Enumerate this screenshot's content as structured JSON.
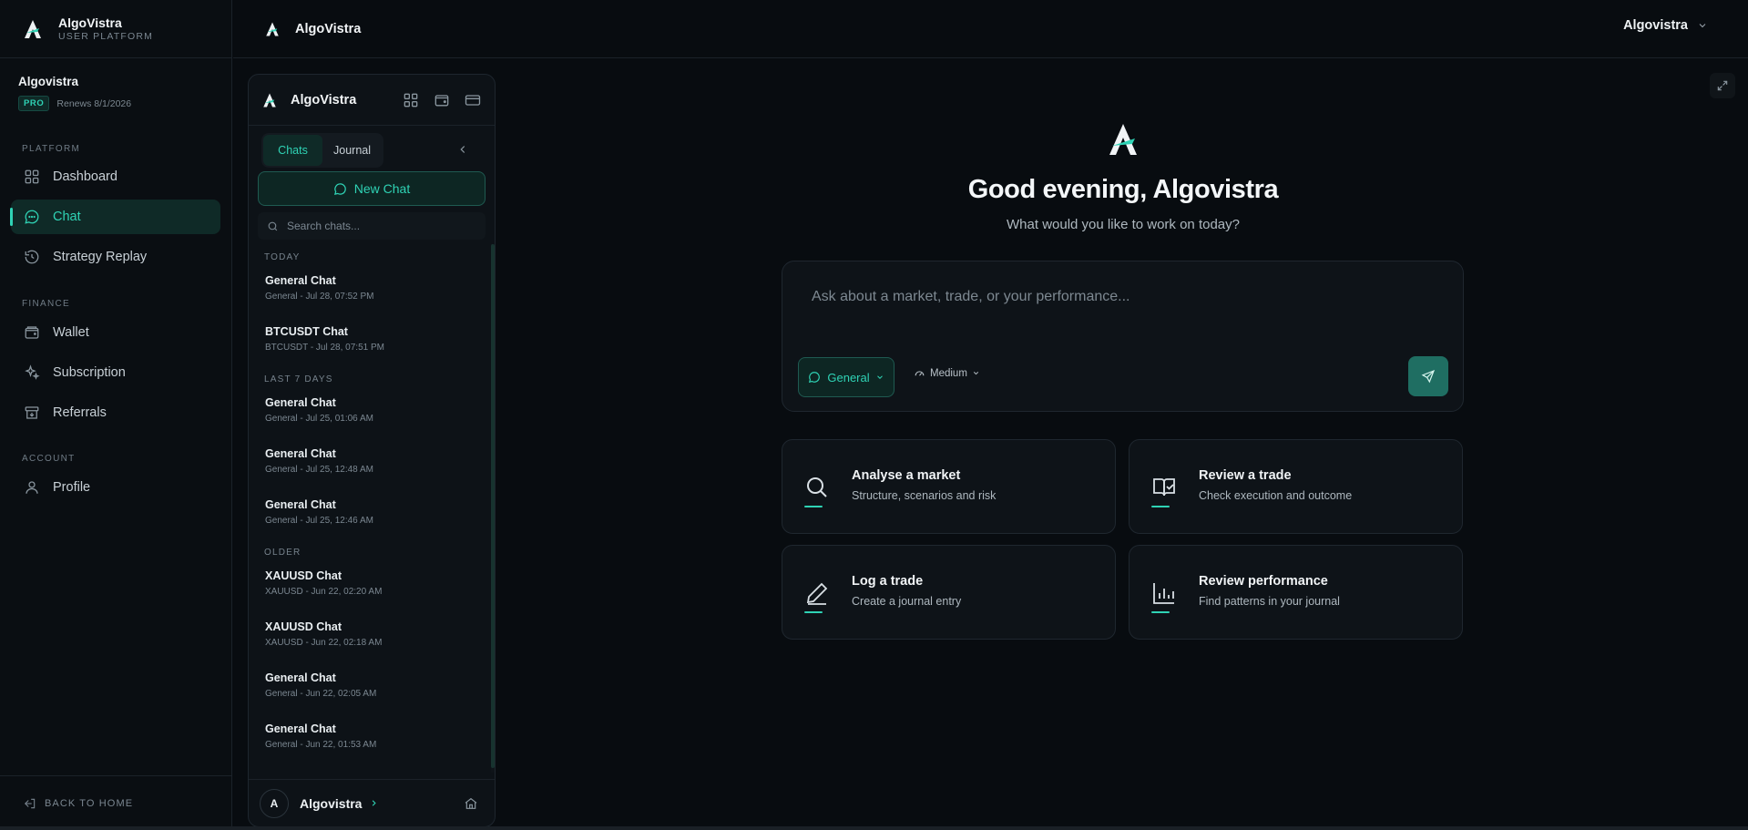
{
  "brand": {
    "name": "AlgoVistra",
    "subtitle": "USER PLATFORM"
  },
  "account": {
    "name": "Algovistra",
    "plan": "PRO",
    "renewal": "Renews 8/1/2026"
  },
  "nav": {
    "platform_label": "PLATFORM",
    "finance_label": "FINANCE",
    "account_label": "ACCOUNT",
    "items": [
      {
        "label": "Dashboard",
        "icon": "grid-icon"
      },
      {
        "label": "Chat",
        "icon": "chat-bubble-icon",
        "active": true
      },
      {
        "label": "Strategy Replay",
        "icon": "replay-icon"
      },
      {
        "label": "Wallet",
        "icon": "wallet-icon"
      },
      {
        "label": "Subscription",
        "icon": "sparkle-icon"
      },
      {
        "label": "Referrals",
        "icon": "gift-icon"
      },
      {
        "label": "Profile",
        "icon": "user-icon"
      }
    ],
    "back_home": "BACK TO HOME"
  },
  "header": {
    "title": "AlgoVistra",
    "user": "Algovistra"
  },
  "panel": {
    "title": "AlgoVistra",
    "tabs": [
      {
        "label": "Chats",
        "active": true
      },
      {
        "label": "Journal"
      }
    ],
    "new_chat_label": "New Chat",
    "search_placeholder": "Search chats...",
    "groups": [
      {
        "label": "TODAY",
        "chats": [
          {
            "title": "General Chat",
            "meta": "General - Jul 28, 07:52 PM"
          },
          {
            "title": "BTCUSDT Chat",
            "meta": "BTCUSDT - Jul 28, 07:51 PM"
          }
        ]
      },
      {
        "label": "LAST 7 DAYS",
        "chats": [
          {
            "title": "General Chat",
            "meta": "General - Jul 25, 01:06 AM"
          },
          {
            "title": "General Chat",
            "meta": "General - Jul 25, 12:48 AM"
          },
          {
            "title": "General Chat",
            "meta": "General - Jul 25, 12:46 AM"
          }
        ]
      },
      {
        "label": "OLDER",
        "chats": [
          {
            "title": "XAUUSD Chat",
            "meta": "XAUUSD - Jun 22, 02:20 AM"
          },
          {
            "title": "XAUUSD Chat",
            "meta": "XAUUSD - Jun 22, 02:18 AM"
          },
          {
            "title": "General Chat",
            "meta": "General - Jun 22, 02:05 AM"
          },
          {
            "title": "General Chat",
            "meta": "General - Jun 22, 01:53 AM"
          }
        ]
      }
    ],
    "footer_user": "Algovistra",
    "avatar_initial": "A"
  },
  "main": {
    "greeting": "Good evening, Algovistra",
    "subtitle": "What would you like to work on today?",
    "composer_placeholder": "Ask about a market, trade, or your performance...",
    "mode_label": "General",
    "effort_label": "Medium",
    "cards": [
      {
        "title": "Analyse a market",
        "desc": "Structure, scenarios and risk",
        "icon": "magnifier-icon"
      },
      {
        "title": "Review a trade",
        "desc": "Check execution and outcome",
        "icon": "book-check-icon"
      },
      {
        "title": "Log a trade",
        "desc": "Create a journal entry",
        "icon": "pen-icon"
      },
      {
        "title": "Review performance",
        "desc": "Find patterns in your journal",
        "icon": "bar-chart-icon"
      }
    ]
  },
  "colors": {
    "accent": "#2fd3b5",
    "background": "#080c10",
    "panel": "#0d1217"
  }
}
